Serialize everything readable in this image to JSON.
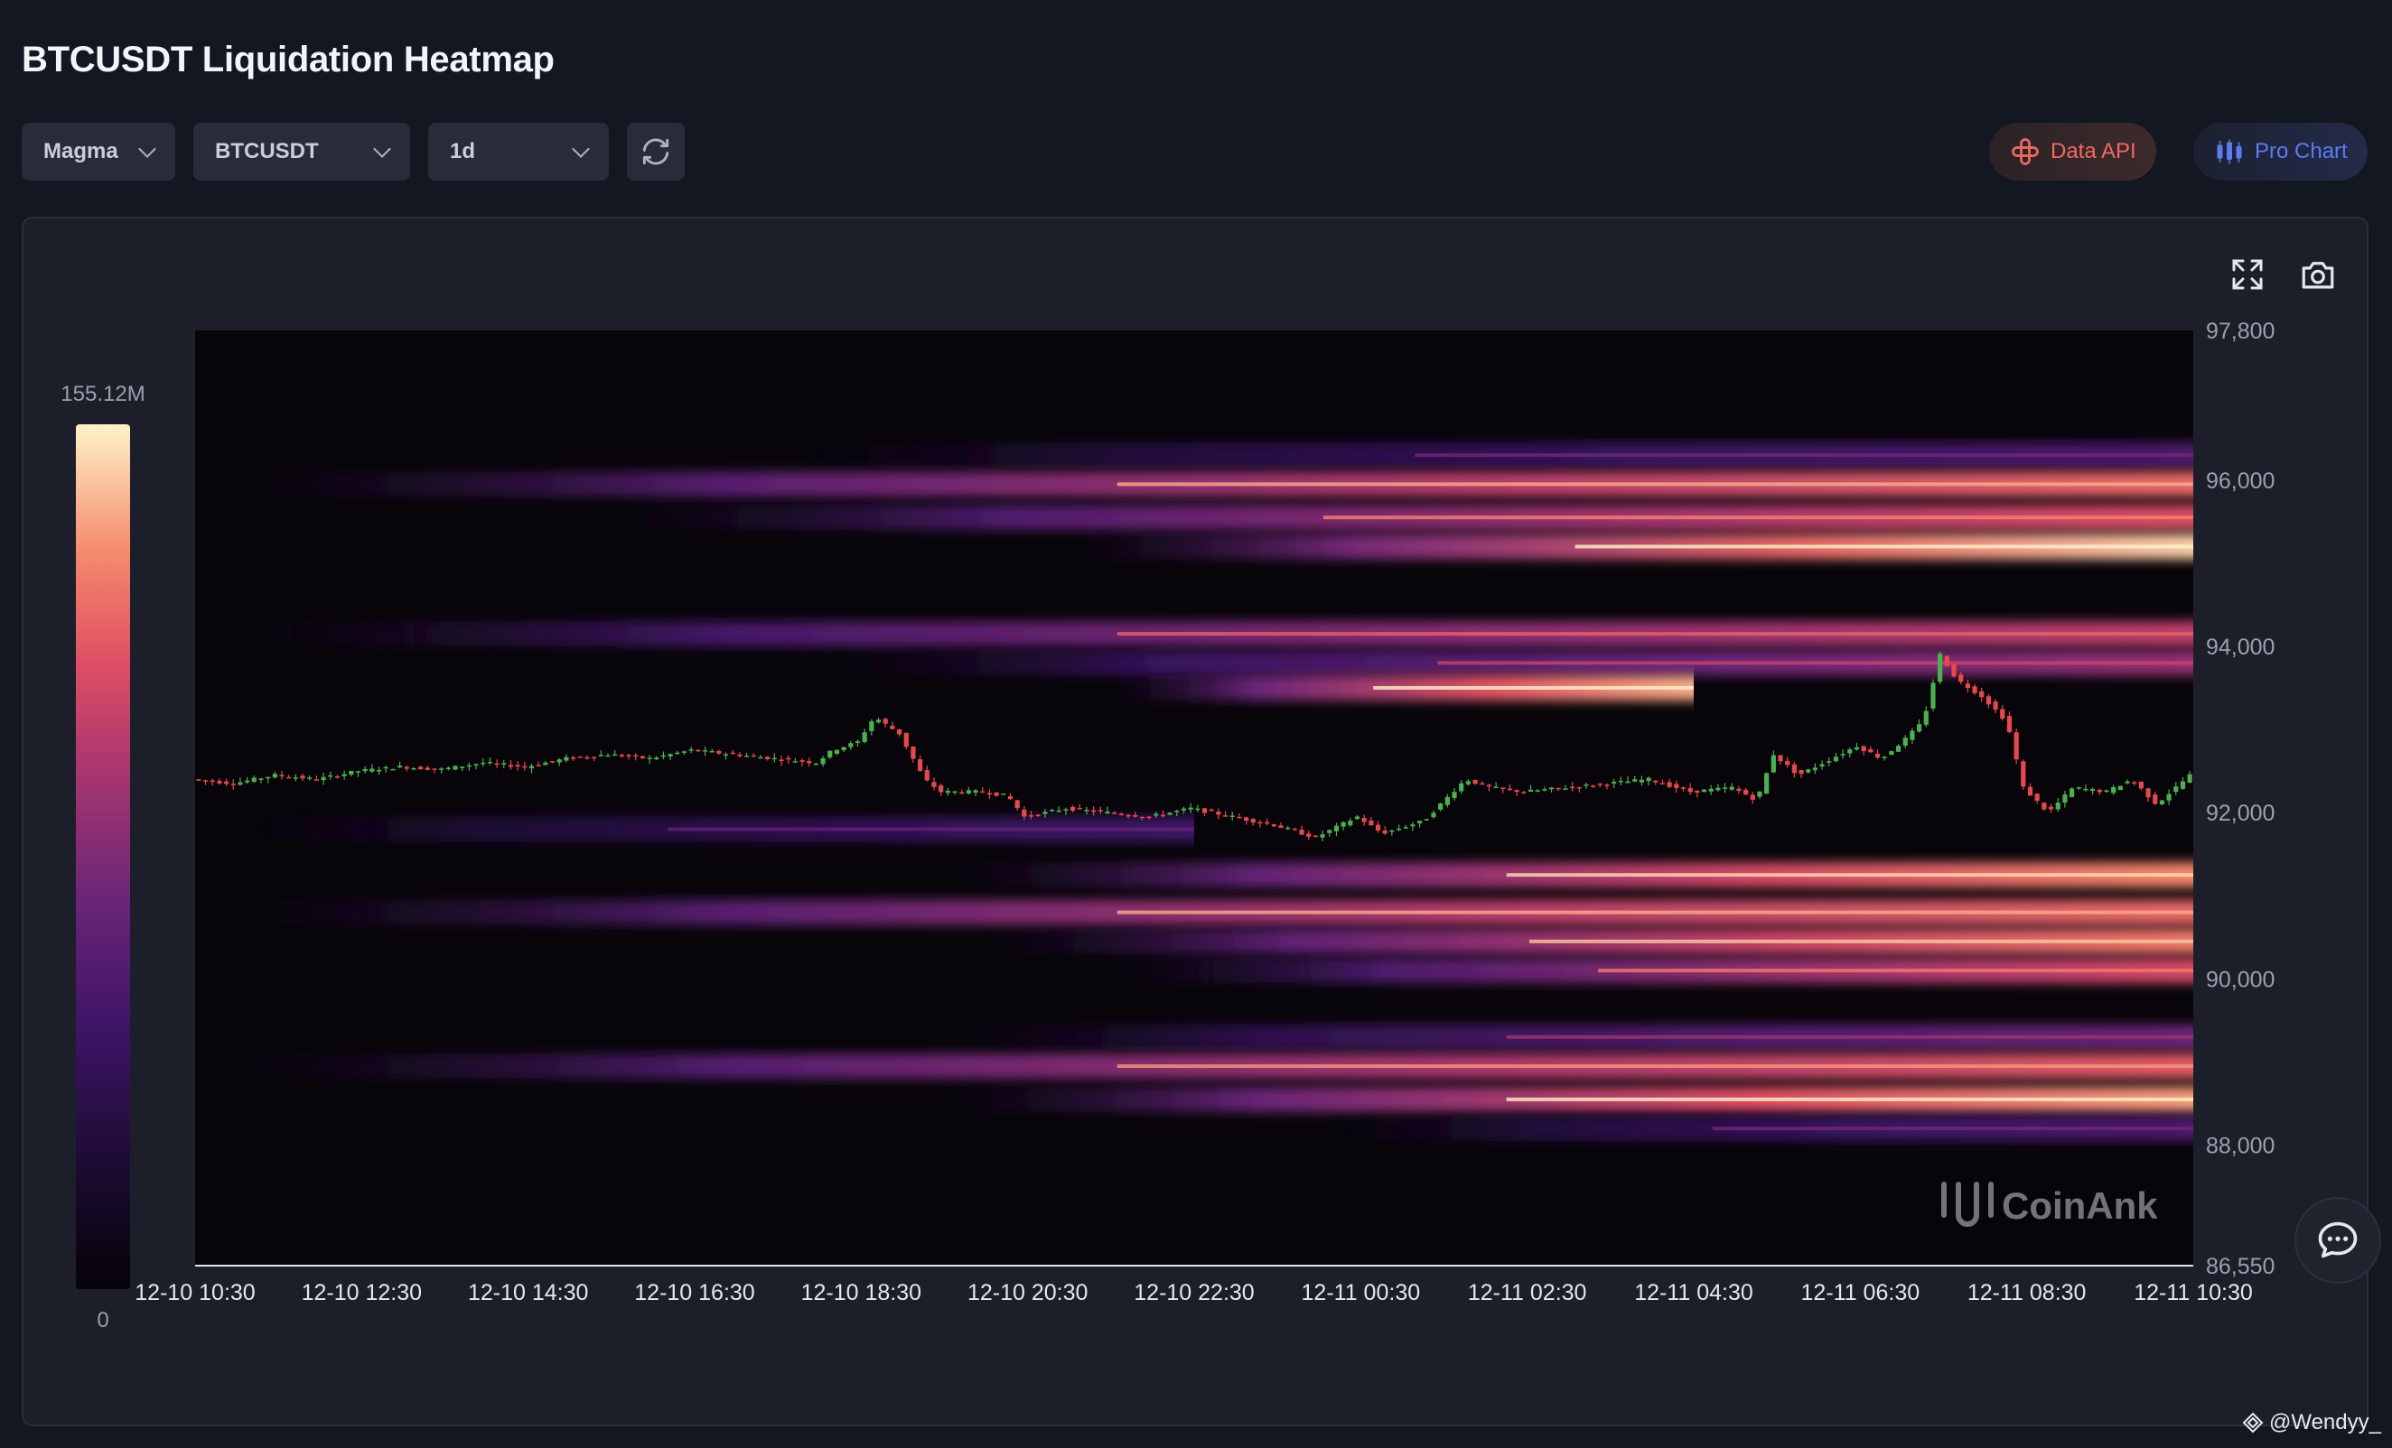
{
  "page": {
    "title": "BTCUSDT Liquidation Heatmap"
  },
  "toolbar": {
    "palette": "Magma",
    "symbol": "BTCUSDT",
    "range": "1d",
    "refresh_icon": "refresh-icon"
  },
  "actions": {
    "data_api": "Data API",
    "data_api_icon": "api-icon",
    "pro_chart": "Pro Chart",
    "pro_chart_icon": "candles-icon",
    "fullscreen_icon": "expand-icon",
    "screenshot_icon": "camera-icon",
    "chat_icon": "chat-bubble-icon"
  },
  "colorbar": {
    "max_label": "155.12M",
    "min_label": "0"
  },
  "watermark": "CoinAnk",
  "credit": "@Wendyy_",
  "colors": {
    "up": "#4caf50",
    "down": "#e5484d",
    "background": "#131722"
  },
  "chart_data": {
    "type": "heatmap",
    "title": "BTCUSDT Liquidation Heatmap",
    "x_ticks": [
      "12-10 10:30",
      "12-10 12:30",
      "12-10 14:30",
      "12-10 16:30",
      "12-10 18:30",
      "12-10 20:30",
      "12-10 22:30",
      "12-11 00:30",
      "12-11 02:30",
      "12-11 04:30",
      "12-11 06:30",
      "12-11 08:30",
      "12-11 10:30"
    ],
    "y_ticks": [
      97800,
      96000,
      94000,
      92000,
      90000,
      88000,
      86550
    ],
    "y_tick_labels": [
      "97,800",
      "96,000",
      "94,000",
      "92,000",
      "90,000",
      "88,000",
      "86,550"
    ],
    "ylim": [
      86550,
      97800
    ],
    "xlim_hours": [
      0,
      24
    ],
    "colorscale": "Magma",
    "value_range": [
      0,
      155.12
    ],
    "value_unit": "M",
    "bands": [
      {
        "price": 96300,
        "start_h": 7.0,
        "end_h": 24,
        "intensity": 0.35
      },
      {
        "price": 95950,
        "start_h": 0.5,
        "end_h": 24,
        "intensity": 0.78
      },
      {
        "price": 95550,
        "start_h": 5.0,
        "end_h": 24,
        "intensity": 0.72
      },
      {
        "price": 95200,
        "start_h": 10.5,
        "end_h": 24,
        "intensity": 0.95
      },
      {
        "price": 94150,
        "start_h": 0.5,
        "end_h": 24,
        "intensity": 0.65
      },
      {
        "price": 93800,
        "start_h": 7.5,
        "end_h": 24,
        "intensity": 0.55
      },
      {
        "price": 93500,
        "start_h": 11.0,
        "end_h": 18.0,
        "intensity": 0.9
      },
      {
        "price": 91800,
        "start_h": 0.5,
        "end_h": 12.0,
        "intensity": 0.3
      },
      {
        "price": 91250,
        "start_h": 9.0,
        "end_h": 24,
        "intensity": 0.85
      },
      {
        "price": 90800,
        "start_h": 0.5,
        "end_h": 24,
        "intensity": 0.78
      },
      {
        "price": 90450,
        "start_h": 9.5,
        "end_h": 24,
        "intensity": 0.82
      },
      {
        "price": 90100,
        "start_h": 11.0,
        "end_h": 24,
        "intensity": 0.7
      },
      {
        "price": 89300,
        "start_h": 9.0,
        "end_h": 24,
        "intensity": 0.45
      },
      {
        "price": 88950,
        "start_h": 0.5,
        "end_h": 24,
        "intensity": 0.75
      },
      {
        "price": 88550,
        "start_h": 9.0,
        "end_h": 24,
        "intensity": 0.88
      },
      {
        "price": 88200,
        "start_h": 13.5,
        "end_h": 24,
        "intensity": 0.35
      }
    ],
    "price_path": [
      [
        0,
        92400
      ],
      [
        0.5,
        92350
      ],
      [
        1,
        92450
      ],
      [
        1.5,
        92400
      ],
      [
        2,
        92500
      ],
      [
        2.5,
        92550
      ],
      [
        3,
        92520
      ],
      [
        3.5,
        92600
      ],
      [
        4,
        92550
      ],
      [
        4.5,
        92650
      ],
      [
        5,
        92700
      ],
      [
        5.5,
        92650
      ],
      [
        6,
        92750
      ],
      [
        6.5,
        92700
      ],
      [
        7,
        92650
      ],
      [
        7.5,
        92600
      ],
      [
        7.7,
        92750
      ],
      [
        8,
        92850
      ],
      [
        8.2,
        93150
      ],
      [
        8.5,
        92950
      ],
      [
        8.8,
        92400
      ],
      [
        9,
        92250
      ],
      [
        9.5,
        92250
      ],
      [
        9.8,
        92200
      ],
      [
        10,
        91950
      ],
      [
        10.5,
        92050
      ],
      [
        11,
        92000
      ],
      [
        11.5,
        91950
      ],
      [
        12,
        92050
      ],
      [
        12.5,
        91950
      ],
      [
        13,
        91850
      ],
      [
        13.5,
        91700
      ],
      [
        14,
        91950
      ],
      [
        14.3,
        91750
      ],
      [
        14.8,
        91900
      ],
      [
        15,
        92100
      ],
      [
        15.3,
        92400
      ],
      [
        15.6,
        92300
      ],
      [
        16,
        92250
      ],
      [
        16.5,
        92300
      ],
      [
        17,
        92350
      ],
      [
        17.5,
        92400
      ],
      [
        18,
        92250
      ],
      [
        18.5,
        92300
      ],
      [
        18.8,
        92150
      ],
      [
        19,
        92700
      ],
      [
        19.3,
        92450
      ],
      [
        19.6,
        92600
      ],
      [
        20,
        92800
      ],
      [
        20.3,
        92650
      ],
      [
        20.6,
        92900
      ],
      [
        20.8,
        93100
      ],
      [
        21,
        93900
      ],
      [
        21.2,
        93600
      ],
      [
        21.5,
        93400
      ],
      [
        21.8,
        93100
      ],
      [
        22,
        92300
      ],
      [
        22.3,
        92000
      ],
      [
        22.6,
        92300
      ],
      [
        23,
        92250
      ],
      [
        23.3,
        92400
      ],
      [
        23.6,
        92100
      ],
      [
        24,
        92450
      ]
    ]
  }
}
